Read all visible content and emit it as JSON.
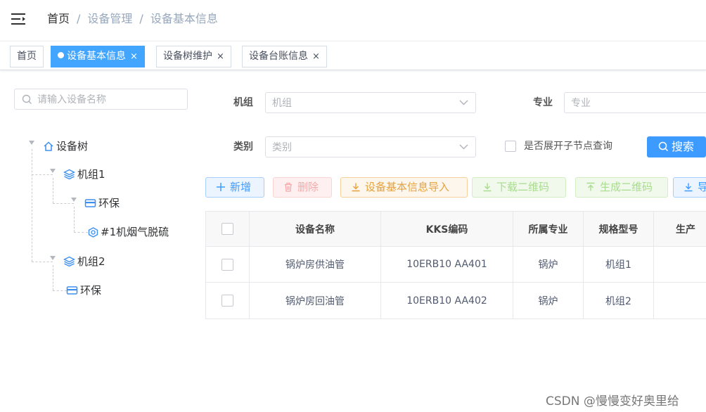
{
  "breadcrumb": [
    "首页",
    "设备管理",
    "设备基本信息"
  ],
  "breadcrumb_sep": "/",
  "tabs": [
    {
      "label": "首页",
      "closable": false,
      "active": false
    },
    {
      "label": "设备基本信息",
      "closable": true,
      "active": true
    },
    {
      "label": "设备树维护",
      "closable": true,
      "active": false
    },
    {
      "label": "设备台账信息",
      "closable": true,
      "active": false
    }
  ],
  "close_glyph": "×",
  "tree": {
    "search_placeholder": "请输入设备名称",
    "root": "设备树",
    "group1": "机组1",
    "group1_child": "环保",
    "group1_grandchild": "#1机烟气脱硫",
    "group2": "机组2",
    "group2_child": "环保"
  },
  "filters": {
    "unit_label": "机组",
    "unit_placeholder": "机组",
    "major_label": "专业",
    "major_placeholder": "专业",
    "category_label": "类别",
    "category_placeholder": "类别",
    "expand_child_label": "是否展开子节点查询",
    "search_button": "搜索"
  },
  "actions": {
    "add": "新增",
    "delete": "删除",
    "import": "设备基本信息导入",
    "download_qr": "下载二维码",
    "generate_qr": "生成二维码",
    "export": "导"
  },
  "table": {
    "headers": [
      "设备名称",
      "KKS编码",
      "所属专业",
      "规格型号",
      "生产"
    ],
    "rows": [
      [
        "锅炉房供油管",
        "10ERB10 AA401",
        "锅炉",
        "机组1",
        ""
      ],
      [
        "锅炉房回油管",
        "10ERB10 AA402",
        "锅炉",
        "机组2",
        ""
      ]
    ]
  },
  "watermark": "CSDN @慢慢变好奥里给",
  "colors": {
    "primary": "#3d9bff",
    "danger_light": "#fab6b6",
    "warning": "#e6a23c",
    "success_light": "#b3e19d"
  }
}
